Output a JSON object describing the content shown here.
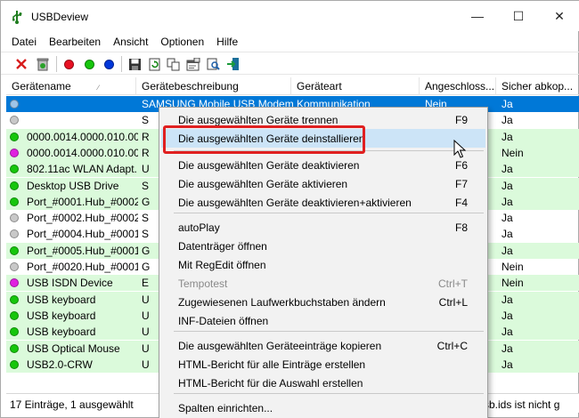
{
  "window": {
    "title": "USBDeview",
    "minimize_symbol": "—",
    "maximize_symbol": "☐",
    "close_symbol": "✕"
  },
  "menubar": [
    "Datei",
    "Bearbeiten",
    "Ansicht",
    "Optionen",
    "Hilfe"
  ],
  "toolbar": {
    "icons": [
      "disconnect-icon",
      "uninstall-icon",
      "red-dot-icon",
      "green-dot-icon",
      "blue-dot-icon",
      "save-icon",
      "refresh-icon",
      "copy-icon",
      "properties-icon",
      "find-icon",
      "exit-icon"
    ],
    "colors": {
      "red": "#e81123",
      "green": "#16c60c",
      "blue": "#0037da"
    }
  },
  "columns": [
    "Gerätename",
    "Gerätebeschreibung",
    "Geräteart",
    "Angeschloss...",
    "Sicher abkop..."
  ],
  "rows": [
    {
      "dot": "#9ec4e8",
      "name": "",
      "desc": "SAMSUNG Mobile USB Modem",
      "type": "Kommunikation",
      "connected": "Nein",
      "safe": "Ja",
      "selected": true,
      "green": false
    },
    {
      "dot": "#c8c8c8",
      "name": "",
      "desc": "S",
      "type": "",
      "connected": "",
      "safe": "Ja",
      "selected": false,
      "green": false
    },
    {
      "dot": "#16c60c",
      "name": "0000.0014.0000.010.00...",
      "desc": "R",
      "type": "",
      "connected": "",
      "safe": "Ja",
      "selected": false,
      "green": true
    },
    {
      "dot": "#e020e0",
      "name": "0000.0014.0000.010.00...",
      "desc": "R",
      "type": "",
      "connected": "",
      "safe": "Nein",
      "selected": false,
      "green": true
    },
    {
      "dot": "#16c60c",
      "name": "802.11ac WLAN Adapt...",
      "desc": "U",
      "type": "",
      "connected": "",
      "safe": "Ja",
      "selected": false,
      "green": true
    },
    {
      "dot": "#16c60c",
      "name": "Desktop USB Drive",
      "desc": "S",
      "type": "",
      "connected": "",
      "safe": "Ja",
      "selected": false,
      "green": true
    },
    {
      "dot": "#16c60c",
      "name": "Port_#0001.Hub_#0002",
      "desc": "G",
      "type": "",
      "connected": "",
      "safe": "Ja",
      "selected": false,
      "green": true
    },
    {
      "dot": "#c8c8c8",
      "name": "Port_#0002.Hub_#0002",
      "desc": "S",
      "type": "",
      "connected": "",
      "safe": "Ja",
      "selected": false,
      "green": false
    },
    {
      "dot": "#c8c8c8",
      "name": "Port_#0004.Hub_#0001",
      "desc": "S",
      "type": "",
      "connected": "",
      "safe": "Ja",
      "selected": false,
      "green": false
    },
    {
      "dot": "#16c60c",
      "name": "Port_#0005.Hub_#0001",
      "desc": "G",
      "type": "",
      "connected": "",
      "safe": "Ja",
      "selected": false,
      "green": true
    },
    {
      "dot": "#c8c8c8",
      "name": "Port_#0020.Hub_#0001",
      "desc": "G",
      "type": "",
      "connected": "",
      "safe": "Nein",
      "selected": false,
      "green": false
    },
    {
      "dot": "#e020e0",
      "name": "USB ISDN Device",
      "desc": "E",
      "type": "",
      "connected": "",
      "safe": "Nein",
      "selected": false,
      "green": true
    },
    {
      "dot": "#16c60c",
      "name": "USB keyboard",
      "desc": "U",
      "type": "",
      "connected": "",
      "safe": "Ja",
      "selected": false,
      "green": true
    },
    {
      "dot": "#16c60c",
      "name": "USB keyboard",
      "desc": "U",
      "type": "",
      "connected": "",
      "safe": "Ja",
      "selected": false,
      "green": true
    },
    {
      "dot": "#16c60c",
      "name": "USB keyboard",
      "desc": "U",
      "type": "",
      "connected": "",
      "safe": "Ja",
      "selected": false,
      "green": true
    },
    {
      "dot": "#16c60c",
      "name": "USB Optical Mouse",
      "desc": "U",
      "type": "",
      "connected": "",
      "safe": "Ja",
      "selected": false,
      "green": true
    },
    {
      "dot": "#16c60c",
      "name": "USB2.0-CRW",
      "desc": "U",
      "type": "",
      "connected": "",
      "safe": "Ja",
      "selected": false,
      "green": true
    }
  ],
  "statusbar": {
    "left": "17 Einträge, 1 ausgewählt",
    "right": "sb.ids ist nicht g"
  },
  "context_menu": {
    "items": [
      {
        "label": "Die ausgewählten Geräte trennen",
        "shortcut": "F9",
        "disabled": false,
        "hover": false
      },
      {
        "label": "Die ausgewählten Geräte deinstallieren",
        "shortcut": "",
        "disabled": false,
        "hover": true
      },
      {
        "label": "Die ausgewählten Geräte deaktivieren",
        "shortcut": "F6",
        "disabled": false,
        "hover": false
      },
      {
        "label": "Die ausgewählten Geräte aktivieren",
        "shortcut": "F7",
        "disabled": false,
        "hover": false
      },
      {
        "label": "Die ausgewählten Geräte deaktivieren+aktivieren",
        "shortcut": "F4",
        "disabled": false,
        "hover": false
      },
      {
        "label": "autoPlay",
        "shortcut": "F8",
        "disabled": false,
        "hover": false
      },
      {
        "label": "Datenträger öffnen",
        "shortcut": "",
        "disabled": false,
        "hover": false
      },
      {
        "label": "Mit RegEdit öffnen",
        "shortcut": "",
        "disabled": false,
        "hover": false
      },
      {
        "label": "Tempotest",
        "shortcut": "Ctrl+T",
        "disabled": true,
        "hover": false
      },
      {
        "label": "Zugewiesenen Laufwerkbuchstaben ändern",
        "shortcut": "Ctrl+L",
        "disabled": false,
        "hover": false
      },
      {
        "label": "INF-Dateien öffnen",
        "shortcut": "",
        "disabled": false,
        "hover": false
      },
      {
        "label": "Die ausgewählten Geräteeinträge kopieren",
        "shortcut": "Ctrl+C",
        "disabled": false,
        "hover": false
      },
      {
        "label": "HTML-Bericht für alle Einträge erstellen",
        "shortcut": "",
        "disabled": false,
        "hover": false
      },
      {
        "label": "HTML-Bericht für die Auswahl erstellen",
        "shortcut": "",
        "disabled": false,
        "hover": false
      },
      {
        "label": "Spalten einrichten...",
        "shortcut": "",
        "disabled": false,
        "hover": false
      }
    ]
  },
  "highlight_color": "#e02020"
}
